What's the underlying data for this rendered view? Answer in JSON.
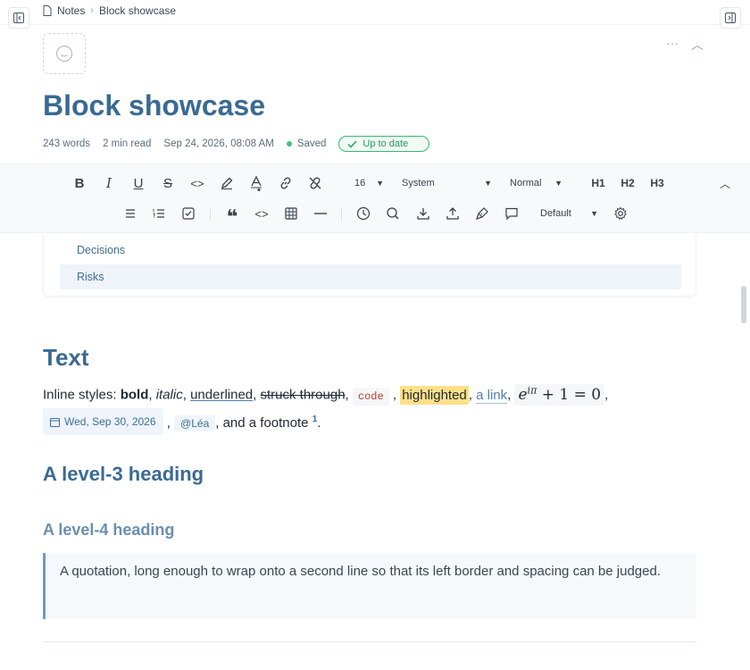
{
  "breadcrumb": {
    "root": "Notes",
    "current": "Block showcase"
  },
  "page": {
    "title": "Block showcase",
    "words": "243 words",
    "read_time": "2 min read",
    "date": "Sep 24, 2026, 08:08 AM",
    "saved": "Saved",
    "status": "Up to date"
  },
  "toolbar": {
    "row1_icons": [
      "bold-icon",
      "italic-icon",
      "underline-icon",
      "strikethrough-icon",
      "code-icon",
      "highlight-pen-icon",
      "text-color-icon",
      "link-icon",
      "unlink-icon"
    ],
    "font_size": "16",
    "font_family": "System",
    "style": "Normal",
    "h1": "H1",
    "h2": "H2",
    "h3": "H3",
    "row2_icons": [
      "bullet-list-icon",
      "numbered-list-icon",
      "checklist-icon",
      "quote-icon",
      "code-block-icon",
      "table-icon",
      "divider-icon",
      "clock-icon",
      "search-icon",
      "download-icon",
      "share-icon",
      "draw-icon",
      "comment-icon",
      "settings-icon"
    ],
    "theme": "Default"
  },
  "toc": {
    "items": [
      "Decisions",
      "Risks"
    ]
  },
  "content": {
    "h2": "Text",
    "inline_label": "Inline styles: ",
    "bold": "bold",
    "italic": "italic",
    "underlined": "underlined",
    "struck": "struck through",
    "code": "code",
    "highlighted": "highlighted",
    "link": "a link",
    "date_chip": "Wed, Sep 30, 2026",
    "mention": "@Léa",
    "footnote_text": ", and a footnote",
    "footnote_num": "1",
    "h3": "A level-3 heading",
    "h4": "A level-4 heading",
    "quote": "A quotation, long enough to wrap onto a second line so that its left border and spacing can be judged."
  },
  "colors": {
    "accent": "#3a6a93",
    "saved_dot": "#3cc47c",
    "quote_border": "#6c98c7",
    "highlight": "#fce08a"
  }
}
